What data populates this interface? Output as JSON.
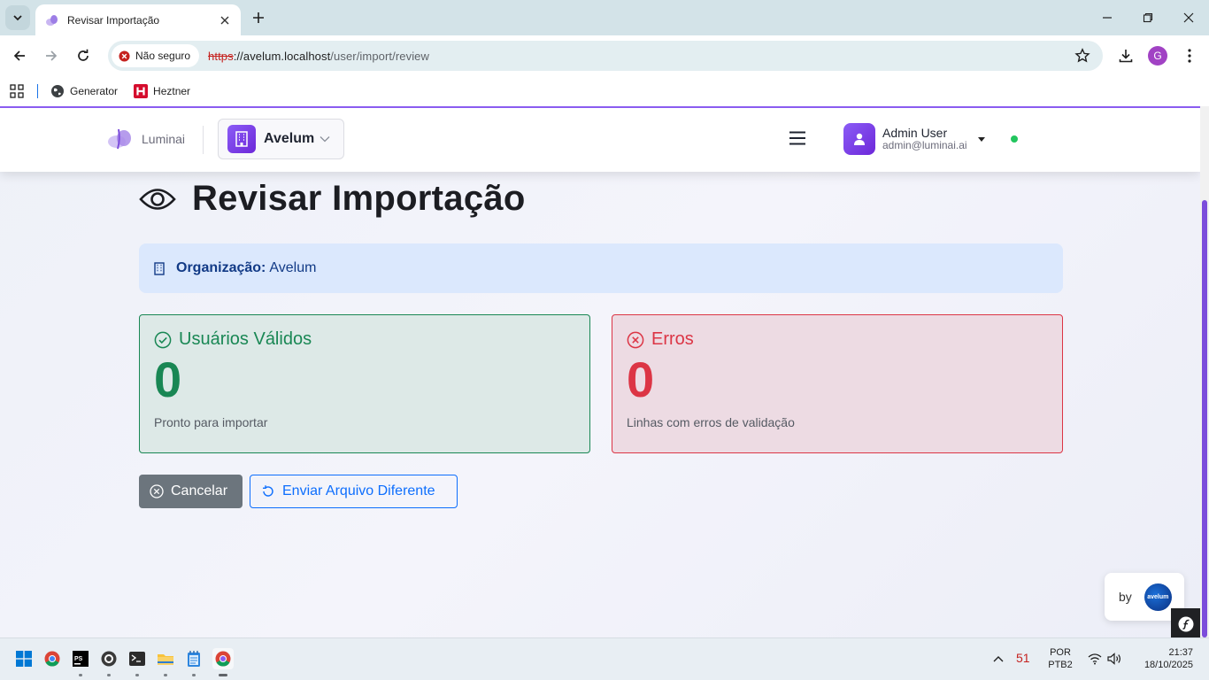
{
  "browser": {
    "tab_title": "Revisar Importação",
    "security_label": "Não seguro",
    "url_scheme": "https",
    "url_host": "://avelum.localhost",
    "url_path": "/user/import/review",
    "profile_initial": "G",
    "bookmarks": [
      {
        "label": "Generator",
        "icon": "globe-icon"
      },
      {
        "label": "Heztner",
        "icon": "hetzner-icon"
      }
    ]
  },
  "header": {
    "brand": "Luminai",
    "org_name": "Avelum",
    "user_name": "Admin User",
    "user_email": "admin@luminai.ai"
  },
  "page": {
    "title": "Revisar Importação",
    "org_label": "Organização:",
    "org_value": "Avelum"
  },
  "cards": {
    "valid": {
      "title": "Usuários Válidos",
      "count": "0",
      "subtitle": "Pronto para importar"
    },
    "errors": {
      "title": "Erros",
      "count": "0",
      "subtitle": "Linhas com erros de validação"
    }
  },
  "actions": {
    "cancel": "Cancelar",
    "upload_different": "Enviar Arquivo Diferente"
  },
  "badge": {
    "by": "by",
    "logo_text": "avelum"
  },
  "taskbar": {
    "temperature": "51",
    "lang_top": "POR",
    "lang_bottom": "PTB2",
    "time": "21:37",
    "date": "18/10/2025"
  },
  "colors": {
    "accent": "#7c4ddb",
    "success": "#198754",
    "danger": "#dc3545",
    "primary": "#0d6efd",
    "secondary": "#6c757d"
  }
}
